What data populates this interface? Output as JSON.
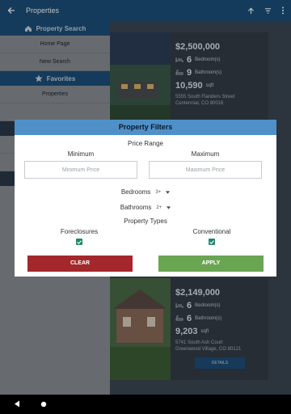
{
  "appbar": {
    "title": "Properties"
  },
  "drawer": {
    "sections": [
      {
        "label": "Property Search",
        "icon": "home-icon"
      },
      {
        "label": "Favorites",
        "icon": "star-icon"
      }
    ],
    "search_items": [
      "Home Page",
      "New Search"
    ],
    "favorite_items": [
      "Properties"
    ]
  },
  "listings": [
    {
      "price": "$2,500,000",
      "bedrooms": "6",
      "bedrooms_label": "Bedroom(s)",
      "bathrooms": "9",
      "bathrooms_label": "Bathroom(s)",
      "sqft": "10,590",
      "sqft_label": "sqft",
      "address_line1": "5555 South Flanders Street",
      "address_line2": "Centennial, CO 80016"
    },
    {
      "price": "$2,149,000",
      "bedrooms": "6",
      "bedrooms_label": "Bedroom(s)",
      "bathrooms": "6",
      "bathrooms_label": "Bathroom(s)",
      "sqft": "9,203",
      "sqft_label": "sqft",
      "address_line1": "5741 South Ash Court",
      "address_line2": "Greenwood Village, CO 80121",
      "details_label": "DETAILS"
    }
  ],
  "filters": {
    "title": "Property Filters",
    "price_range_label": "Price Range",
    "minimum_label": "Minimum",
    "maximum_label": "Maximum",
    "minimum_placeholder": "Minimum Price",
    "maximum_placeholder": "Maximum Price",
    "bedrooms_label": "Bedrooms",
    "bedrooms_value": "3+",
    "bathrooms_label": "Bathrooms",
    "bathrooms_value": "2+",
    "property_types_label": "Property Types",
    "foreclosures_label": "Foreclosures",
    "foreclosures_checked": true,
    "conventional_label": "Conventional",
    "conventional_checked": true,
    "clear_label": "CLEAR",
    "apply_label": "APPLY"
  },
  "colors": {
    "appbar": "#1b4f7a",
    "dialog_header": "#4f90c9",
    "clear_button": "#a3282c",
    "apply_button": "#6aa552",
    "checkbox": "#1f8a6e"
  }
}
